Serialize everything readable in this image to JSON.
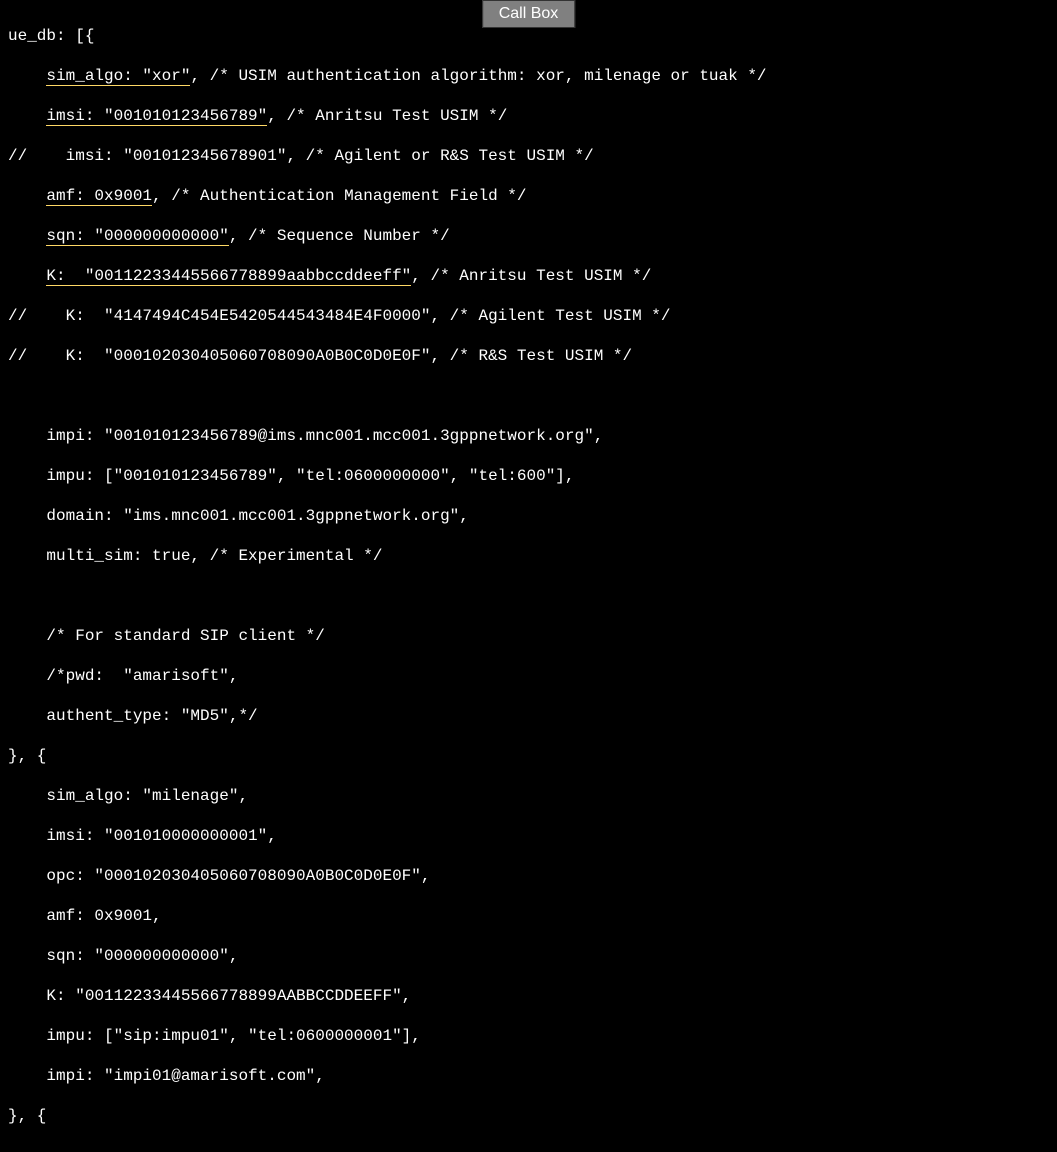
{
  "header": {
    "title": "Call Box"
  },
  "code": {
    "line1": "ue_db: [{",
    "line2_hl": "sim_algo: \"xor\"",
    "line2_rest": ", /* USIM authentication algorithm: xor, milenage or tuak */",
    "line3_hl": "imsi: \"001010123456789\"",
    "line3_rest": ", /* Anritsu Test USIM */",
    "line4": "//    imsi: \"001012345678901\", /* Agilent or R&S Test USIM */",
    "line5_hl": "amf: 0x9001",
    "line5_rest": ", /* Authentication Management Field */",
    "line6_hl": "sqn: \"000000000000\"",
    "line6_rest": ", /* Sequence Number */",
    "line7_hl": "K:  \"00112233445566778899aabbccddeeff\"",
    "line7_rest": ", /* Anritsu Test USIM */",
    "line8": "//    K:  \"4147494C454E5420544543484E4F0000\", /* Agilent Test USIM */",
    "line9": "//    K:  \"000102030405060708090A0B0C0D0E0F\", /* R&S Test USIM */",
    "line10": "",
    "line11": "    impi: \"001010123456789@ims.mnc001.mcc001.3gppnetwork.org\",",
    "line12": "    impu: [\"001010123456789\", \"tel:0600000000\", \"tel:600\"],",
    "line13": "    domain: \"ims.mnc001.mcc001.3gppnetwork.org\",",
    "line14": "    multi_sim: true, /* Experimental */",
    "line15": "",
    "line16": "    /* For standard SIP client */",
    "line17": "    /*pwd:  \"amarisoft\",",
    "line18": "    authent_type: \"MD5\",*/",
    "line19": "}, {",
    "line20": "    sim_algo: \"milenage\",",
    "line21": "    imsi: \"001010000000001\",",
    "line22": "    opc: \"000102030405060708090A0B0C0D0E0F\",",
    "line23": "    amf: 0x9001,",
    "line24": "    sqn: \"000000000000\",",
    "line25": "    K: \"00112233445566778899AABBCCDDEEFF\",",
    "line26": "    impu: [\"sip:impu01\", \"tel:0600000001\"],",
    "line27": "    impi: \"impi01@amarisoft.com\",",
    "line28": "}, {"
  }
}
